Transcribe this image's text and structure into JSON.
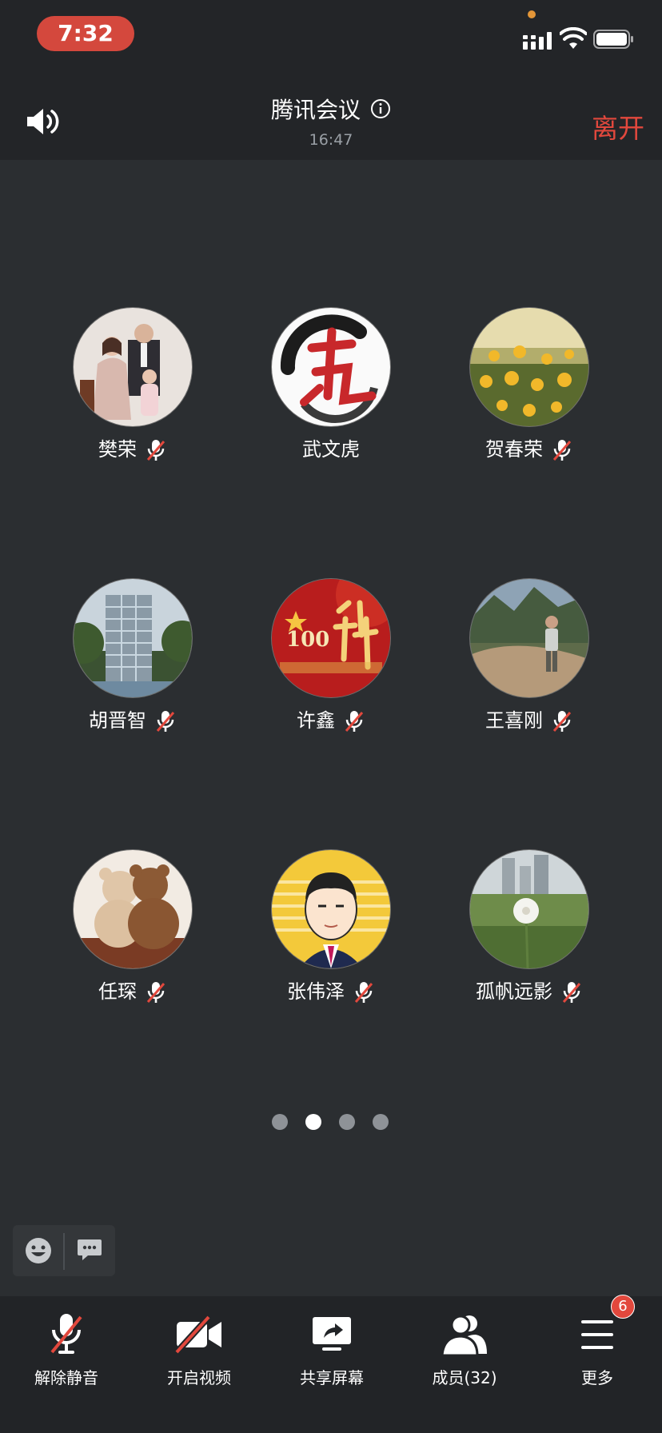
{
  "status_bar": {
    "time": "7:32"
  },
  "header": {
    "title": "腾讯会议",
    "meeting_time": "16:47",
    "leave_label": "离开"
  },
  "participants": [
    {
      "name": "樊荣",
      "muted": true,
      "avatar": "family-photo"
    },
    {
      "name": "武文虎",
      "muted": false,
      "avatar": "calligraphy-wu"
    },
    {
      "name": "贺春荣",
      "muted": true,
      "avatar": "yellow-flowers"
    },
    {
      "name": "胡晋智",
      "muted": true,
      "avatar": "building"
    },
    {
      "name": "许鑫",
      "muted": true,
      "avatar": "red-100-xu"
    },
    {
      "name": "王喜刚",
      "muted": true,
      "avatar": "mountain-man"
    },
    {
      "name": "任琛",
      "muted": true,
      "avatar": "teddy-bears"
    },
    {
      "name": "张伟泽",
      "muted": true,
      "avatar": "cartoon-man"
    },
    {
      "name": "孤帆远影",
      "muted": true,
      "avatar": "dandelion"
    }
  ],
  "pagination": {
    "total": 4,
    "active_index": 1
  },
  "toolbar": {
    "unmute": "解除静音",
    "video": "开启视频",
    "share": "共享屏幕",
    "members": "成员(32)",
    "more": "更多",
    "more_badge": "6"
  },
  "colors": {
    "accent_red": "#e2483d",
    "background": "#2b2e31",
    "bar": "#222427"
  }
}
